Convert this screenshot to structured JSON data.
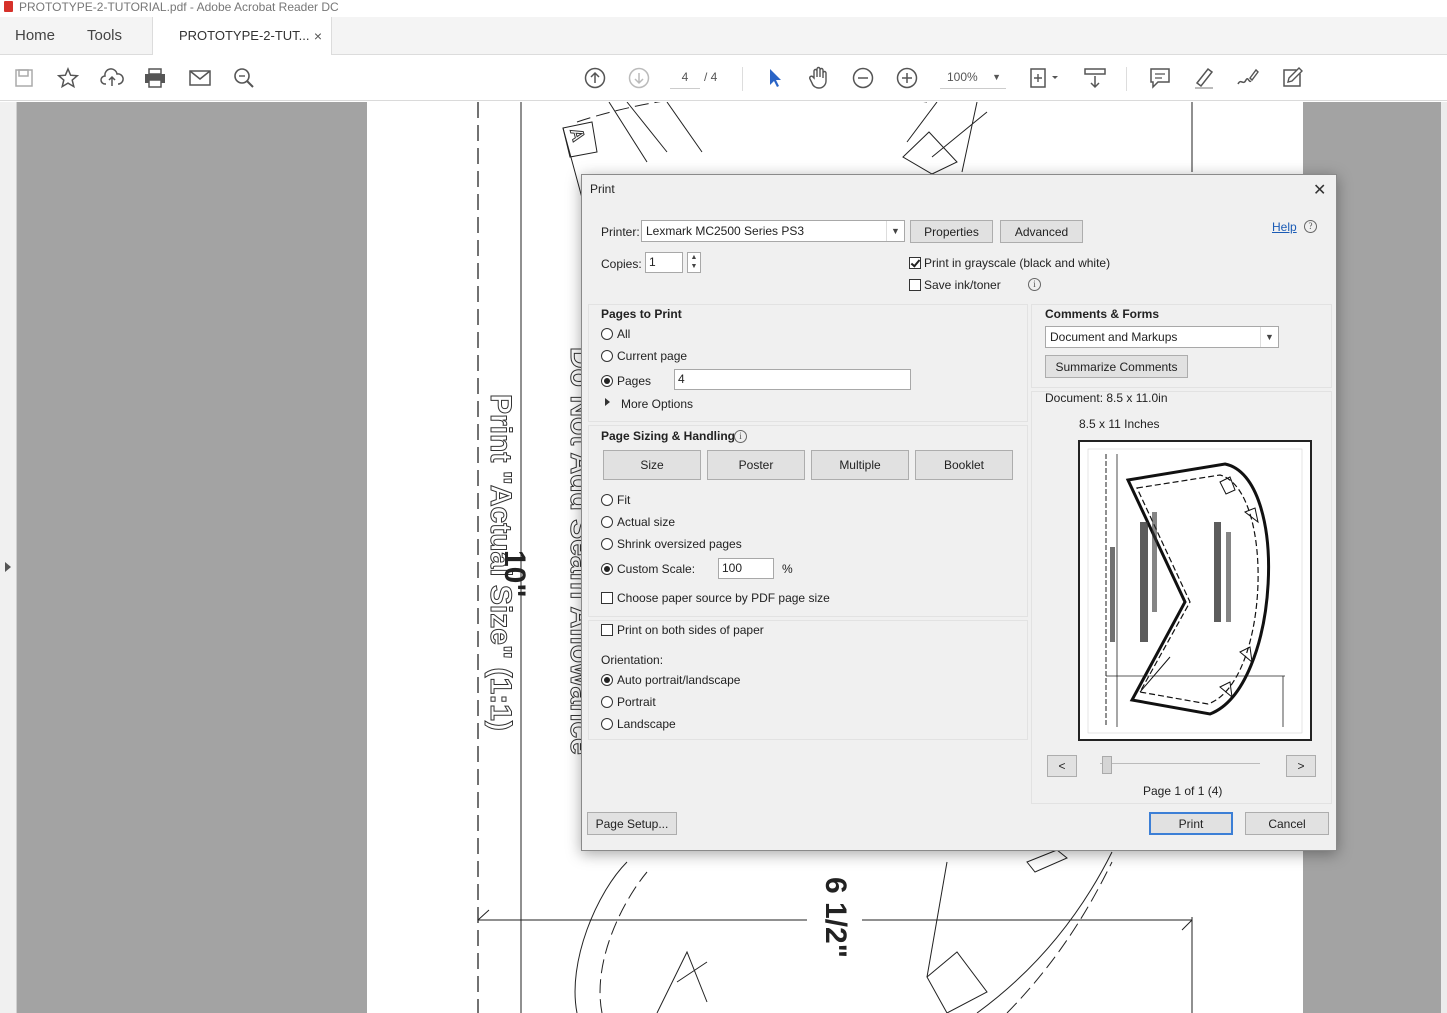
{
  "window": {
    "title": "PROTOTYPE-2-TUTORIAL.pdf - Adobe Acrobat Reader DC"
  },
  "tabs": {
    "home": "Home",
    "tools": "Tools",
    "document": "PROTOTYPE-2-TUT...",
    "close": "×"
  },
  "toolbar": {
    "page_current": "4",
    "page_total": "/ 4",
    "zoom": "100%",
    "icons": [
      "save-icon",
      "star-icon",
      "cloud-upload-icon",
      "print-icon",
      "email-icon",
      "zoom-search-icon",
      "page-up-icon",
      "page-down-icon",
      "select-arrow-icon",
      "hand-icon",
      "zoom-out-icon",
      "zoom-in-icon",
      "page-fit-icon",
      "scroll-icon",
      "comment-icon",
      "highlight-icon",
      "sign-icon",
      "stamp-icon"
    ]
  },
  "document_page": {
    "labels": {
      "vertical_1": "Print \"Actual Size\" (1:1)",
      "vertical_2": "Do Not Add Seam Allowance",
      "dimension_1": "10\"",
      "dimension_2": "6 1/2\"",
      "marker": "A"
    }
  },
  "dialog": {
    "title": "Print",
    "close": "✕",
    "printer_label": "Printer:",
    "printer_value": "Lexmark MC2500 Series PS3",
    "properties_button": "Properties",
    "advanced_button": "Advanced",
    "help_link": "Help",
    "copies_label": "Copies:",
    "copies_value": "1",
    "grayscale_label": "Print in grayscale (black and white)",
    "grayscale_checked": true,
    "save_ink_label": "Save ink/toner",
    "save_ink_checked": false,
    "pages_to_print": {
      "heading": "Pages to Print",
      "all": "All",
      "current_page": "Current page",
      "pages": "Pages",
      "pages_value": "4",
      "selected": "Pages",
      "more_options": "More Options"
    },
    "page_sizing": {
      "heading": "Page Sizing & Handling",
      "buttons": [
        "Size",
        "Poster",
        "Multiple",
        "Booklet"
      ],
      "fit": "Fit",
      "actual_size": "Actual size",
      "shrink": "Shrink oversized pages",
      "custom_scale": "Custom Scale:",
      "custom_scale_value": "100",
      "percent": "%",
      "selected": "Custom Scale:",
      "paper_source": "Choose paper source by PDF page size",
      "paper_source_checked": false
    },
    "both_sides_label": "Print on both sides of paper",
    "both_sides_checked": false,
    "orientation": {
      "heading": "Orientation:",
      "auto": "Auto portrait/landscape",
      "portrait": "Portrait",
      "landscape": "Landscape",
      "selected": "Auto portrait/landscape"
    },
    "comments_forms": {
      "heading": "Comments & Forms",
      "value": "Document and Markups",
      "summarize_button": "Summarize Comments"
    },
    "document_size": "Document: 8.5 x 11.0in",
    "paper_size": "8.5 x 11 Inches",
    "nav_prev": "<",
    "nav_next": ">",
    "page_indicator": "Page 1 of 1 (4)",
    "page_setup_button": "Page Setup...",
    "print_button": "Print",
    "cancel_button": "Cancel"
  }
}
